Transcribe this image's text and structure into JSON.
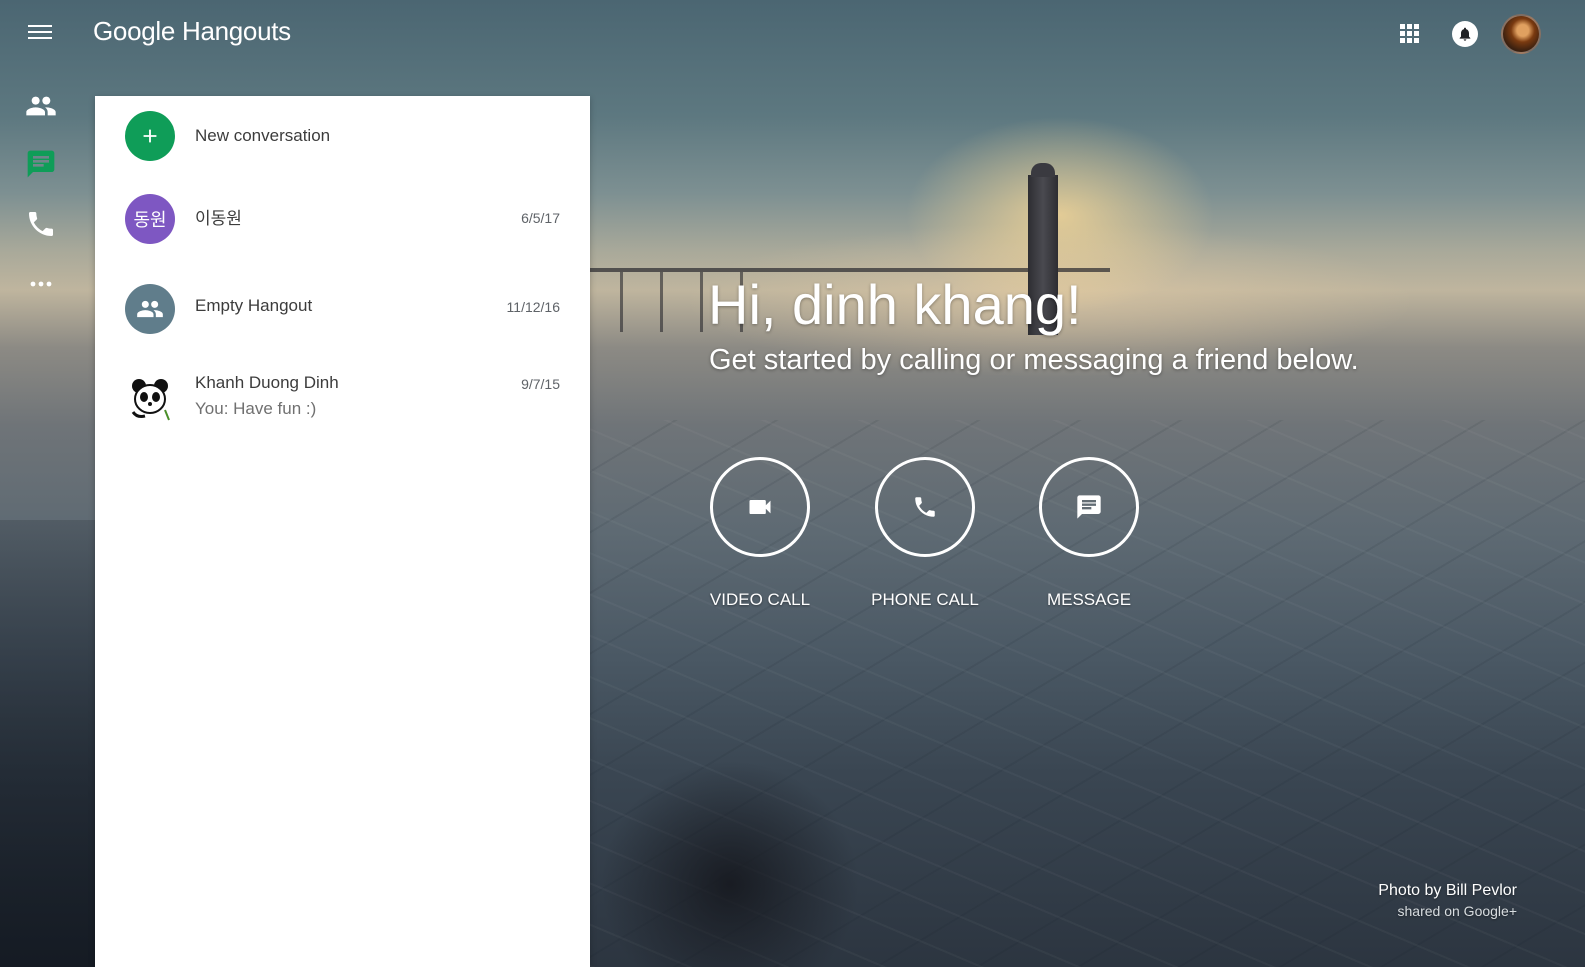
{
  "app": {
    "logo_text": "Google Hangouts"
  },
  "rail": {
    "items": [
      {
        "name": "contacts",
        "icon": "people-icon",
        "active": false
      },
      {
        "name": "conversations",
        "icon": "chat-icon",
        "active": true
      },
      {
        "name": "phone-calls",
        "icon": "phone-icon",
        "active": false
      },
      {
        "name": "more",
        "icon": "more-icon",
        "active": false
      }
    ],
    "active_color": "#0f9d58"
  },
  "panel": {
    "new_conversation_label": "New conversation",
    "new_conversation_color": "#0f9d58",
    "conversations": [
      {
        "name": "이동원",
        "date": "6/5/17",
        "avatar_text": "동원",
        "avatar_color": "#7e57c2",
        "snippet": ""
      },
      {
        "name": "Empty Hangout",
        "date": "11/12/16",
        "avatar_icon": "group-icon",
        "avatar_color": "#607d8b",
        "snippet": ""
      },
      {
        "name": "Khanh Duong Dinh",
        "date": "9/7/15",
        "avatar_icon": "panda-icon",
        "snippet": "You: Have fun :)"
      }
    ]
  },
  "welcome": {
    "greeting": "Hi, dinh khang!",
    "subtitle": "Get started by calling or messaging a friend below.",
    "actions": [
      {
        "label": "VIDEO CALL",
        "icon": "videocam-icon"
      },
      {
        "label": "PHONE CALL",
        "icon": "phone-icon"
      },
      {
        "label": "MESSAGE",
        "icon": "message-icon"
      }
    ]
  },
  "photo_credit": {
    "line1": "Photo by Bill Pevlor",
    "line2": "shared on Google+"
  }
}
